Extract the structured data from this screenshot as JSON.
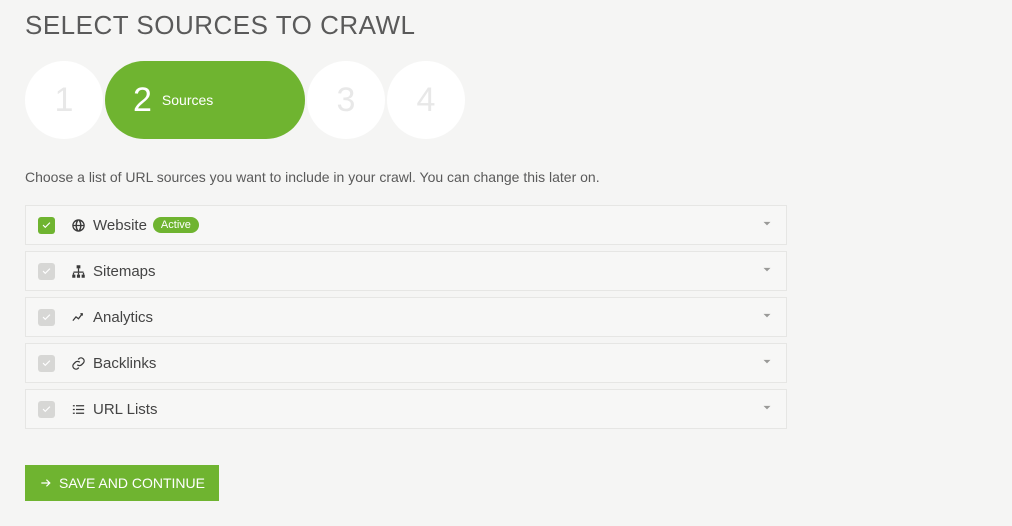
{
  "page_title": "SELECT SOURCES TO CRAWL",
  "stepper": {
    "steps": [
      {
        "num": "1",
        "label": "",
        "active": false
      },
      {
        "num": "2",
        "label": "Sources",
        "active": true
      },
      {
        "num": "3",
        "label": "",
        "active": false
      },
      {
        "num": "4",
        "label": "",
        "active": false
      }
    ]
  },
  "instructions": "Choose a list of URL sources you want to include in your crawl. You can change this later on.",
  "sources": [
    {
      "label": "Website",
      "checked": true,
      "badge": "Active"
    },
    {
      "label": "Sitemaps",
      "checked": false,
      "badge": ""
    },
    {
      "label": "Analytics",
      "checked": false,
      "badge": ""
    },
    {
      "label": "Backlinks",
      "checked": false,
      "badge": ""
    },
    {
      "label": "URL Lists",
      "checked": false,
      "badge": ""
    }
  ],
  "buttons": {
    "save_continue": "SAVE AND CONTINUE"
  },
  "colors": {
    "primary_green": "#6fb430",
    "background": "#f5f5f4"
  }
}
